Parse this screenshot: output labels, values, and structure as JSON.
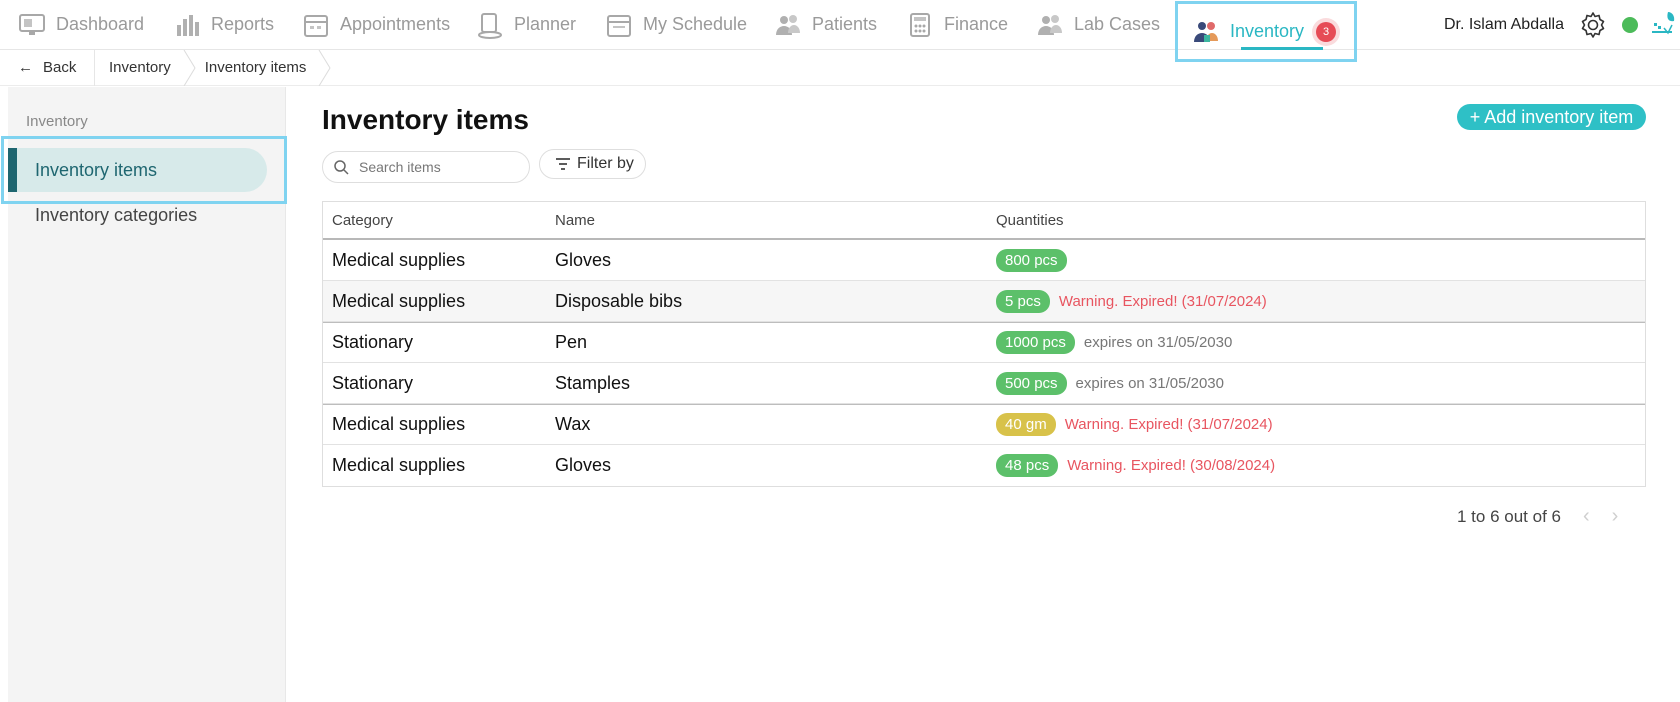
{
  "nav": {
    "items": [
      {
        "label": "Dashboard",
        "icon": "monitor-icon"
      },
      {
        "label": "Reports",
        "icon": "bar-chart-icon"
      },
      {
        "label": "Appointments",
        "icon": "calendar-icon"
      },
      {
        "label": "Planner",
        "icon": "planner-icon"
      },
      {
        "label": "My Schedule",
        "icon": "schedule-icon"
      },
      {
        "label": "Patients",
        "icon": "users-icon"
      },
      {
        "label": "Finance",
        "icon": "calculator-icon"
      },
      {
        "label": "Lab Cases",
        "icon": "lab-icon"
      }
    ],
    "active": {
      "label": "Inventory",
      "icon": "inventory-icon",
      "badge": "3"
    },
    "accent": "#2ab7c3"
  },
  "user": {
    "name": "Dr. Islam Abdalla",
    "status_color": "#4cbb5a"
  },
  "breadcrumb": {
    "back": "Back",
    "items": [
      "Inventory",
      "Inventory items"
    ]
  },
  "sidebar": {
    "heading": "Inventory",
    "items": [
      "Inventory items",
      "Inventory categories"
    ]
  },
  "main": {
    "title": "Inventory items",
    "add_button": "+ Add inventory item",
    "search_placeholder": "Search items",
    "filter_label": "Filter by"
  },
  "table": {
    "columns": [
      "Category",
      "Name",
      "Quantities"
    ],
    "rows": [
      {
        "category": "Medical supplies",
        "name": "Gloves",
        "qty": "800 pcs",
        "note": ""
      },
      {
        "category": "Medical supplies",
        "name": "Disposable bibs",
        "qty": "5 pcs",
        "note": "Warning. Expired! (31/07/2024)"
      },
      {
        "category": "Stationary",
        "name": "Pen",
        "qty": "1000 pcs",
        "note": "expires on 31/05/2030"
      },
      {
        "category": "Stationary",
        "name": "Stamples",
        "qty": "500 pcs",
        "note": "expires on 31/05/2030"
      },
      {
        "category": "Medical supplies",
        "name": "Wax",
        "qty": "40 gm",
        "note": "Warning. Expired! (31/07/2024)"
      },
      {
        "category": "Medical supplies",
        "name": "Gloves",
        "qty": "48 pcs",
        "note": "Warning. Expired! (30/08/2024)"
      }
    ]
  },
  "pagination": {
    "text": "1 to 6 out of 6"
  }
}
